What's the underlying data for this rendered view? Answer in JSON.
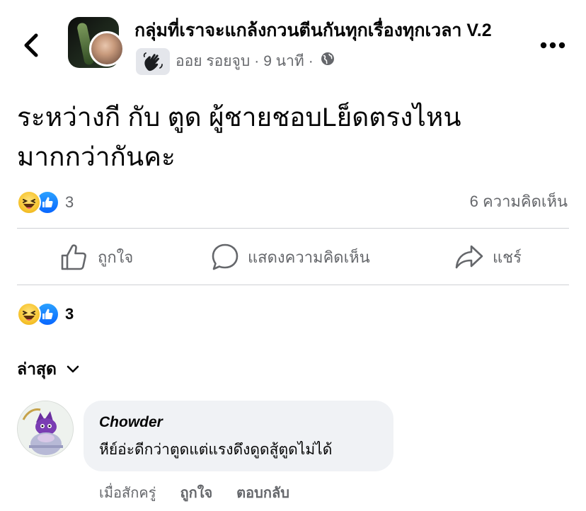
{
  "header": {
    "group_name": "กลุ่มที่เราจะแกล้งกวนตีนกันทุกเรื่องทุกเวลา V.2",
    "author": "ออย รอยจูบ",
    "time": "9 นาที",
    "separator": "·",
    "back_icon": "chevron-left-icon",
    "more_icon": "more-dots-icon",
    "audience_icon": "globe-icon",
    "badge_icon": "wave-hand-icon"
  },
  "post": {
    "lines": [
      "ระหว่างกี กับ ตูด ผู้ชายชอบLย็ดตรงไหน",
      "มากกว่ากันคะ"
    ]
  },
  "reactions": {
    "count": "3",
    "comments": "6 ความคิดเห็น",
    "types": [
      "haha-icon",
      "like-icon"
    ]
  },
  "actions": {
    "like": "ถูกใจ",
    "comment": "แสดงความคิดเห็น",
    "share": "แชร์"
  },
  "reactions_summary": {
    "count": "3"
  },
  "sort": {
    "label": "ล่าสุด"
  },
  "comments": [
    {
      "name": "Chowder",
      "text": "หีย์อ่ะดีกว่าตูดแต่แรงดึงดูดสู้ตูดไม่ได้",
      "time": "เมื่อสักครู่",
      "like": "ถูกใจ",
      "reply": "ตอบกลับ"
    }
  ],
  "colors": {
    "primary_text": "#050505",
    "secondary_text": "#65676b",
    "divider": "#ced0d4",
    "bubble": "#f0f2f5",
    "like_blue": "#0866ff",
    "haha_yellow": "#f7c531"
  }
}
